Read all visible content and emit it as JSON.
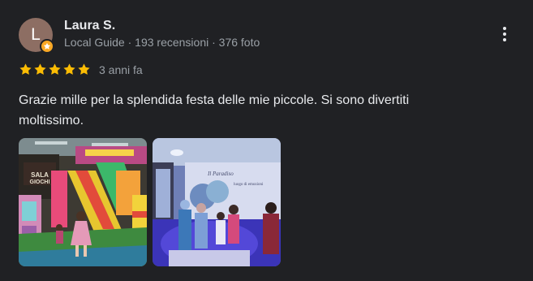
{
  "author": {
    "initial": "L",
    "name": "Laura S.",
    "meta": "Local Guide · 193 recensioni · 376 foto",
    "avatar_color": "#8d6e63",
    "badge_color": "#f9a825",
    "badge_icon": "star-icon"
  },
  "review": {
    "rating": 5,
    "date": "3 anni fa",
    "text": "Grazie mille per la splendida festa delle mie piccole. Si sono divertiti moltissimo."
  },
  "menu": {
    "icon": "more-vert-icon"
  },
  "photos": [
    {
      "subject": "indoor-playground",
      "sign_text": "SALA GIOCHI"
    },
    {
      "subject": "party-room-blue-light",
      "sign_text": "Il Paradiso"
    }
  ],
  "colors": {
    "background": "#202124",
    "primary_text": "#e8eaed",
    "secondary_text": "#9aa0a6",
    "star": "#fbbc04"
  }
}
